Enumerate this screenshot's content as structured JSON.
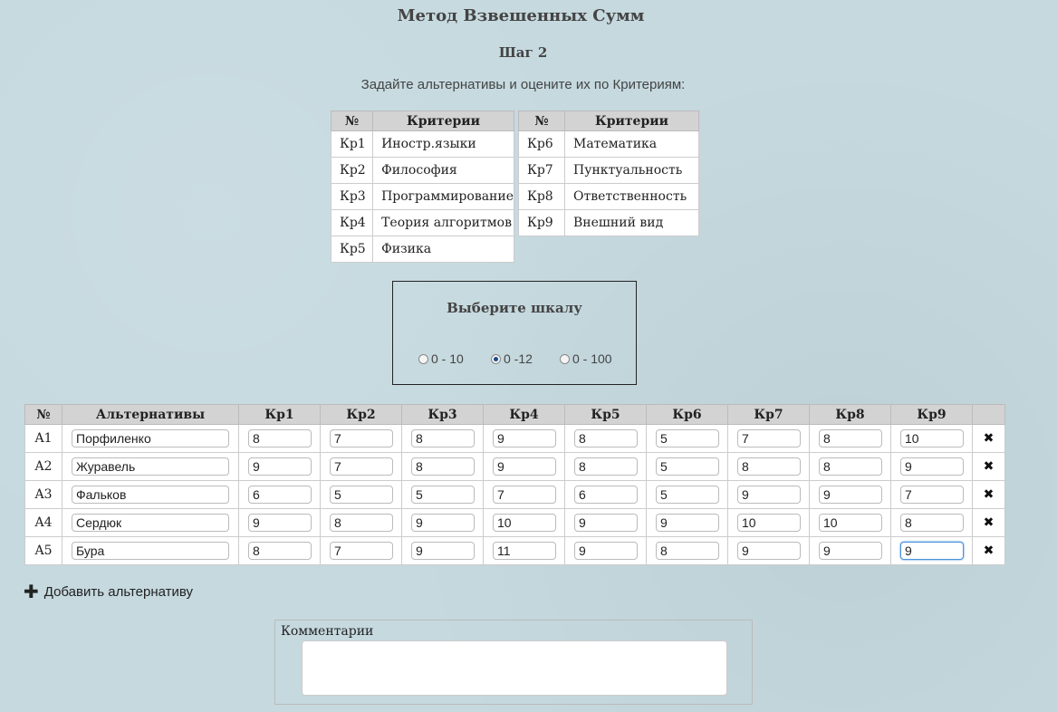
{
  "page": {
    "title": "Метод Взвешенных Сумм",
    "step": "Шаг 2",
    "instructions": "Задайте альтернативы и оцените их по Критериям:"
  },
  "criteria": {
    "headers": [
      "№",
      "Критерии"
    ],
    "left": [
      {
        "id": "Кр1",
        "name": "Иностр.языки"
      },
      {
        "id": "Кр2",
        "name": "Философия"
      },
      {
        "id": "Кр3",
        "name": "Программирование"
      },
      {
        "id": "Кр4",
        "name": "Теория алгоритмов"
      },
      {
        "id": "Кр5",
        "name": "Физика"
      }
    ],
    "right": [
      {
        "id": "Кр6",
        "name": "Математика"
      },
      {
        "id": "Кр7",
        "name": "Пунктуальность"
      },
      {
        "id": "Кр8",
        "name": "Ответственность"
      },
      {
        "id": "Кр9",
        "name": "Внешний вид"
      }
    ]
  },
  "scale": {
    "title": "Выберите шкалу",
    "options": [
      {
        "label": "0 - 10",
        "selected": false
      },
      {
        "label": "0 -12",
        "selected": true
      },
      {
        "label": "0 - 100",
        "selected": false
      }
    ]
  },
  "alternatives": {
    "headers": [
      "№",
      "Альтернативы",
      "Кр1",
      "Кр2",
      "Кр3",
      "Кр4",
      "Кр5",
      "Кр6",
      "Кр7",
      "Кр8",
      "Кр9"
    ],
    "delete_icon": "delete-icon",
    "rows": [
      {
        "id": "A1",
        "name": "Порфиленко",
        "scores": [
          "8",
          "7",
          "8",
          "9",
          "8",
          "5",
          "7",
          "8",
          "10"
        ]
      },
      {
        "id": "A2",
        "name": "Журавель",
        "scores": [
          "9",
          "7",
          "8",
          "9",
          "8",
          "5",
          "8",
          "8",
          "9"
        ]
      },
      {
        "id": "A3",
        "name": "Фальков",
        "scores": [
          "6",
          "5",
          "5",
          "7",
          "6",
          "5",
          "9",
          "9",
          "7"
        ]
      },
      {
        "id": "A4",
        "name": "Сердюк",
        "scores": [
          "9",
          "8",
          "9",
          "10",
          "9",
          "9",
          "10",
          "10",
          "8"
        ]
      },
      {
        "id": "A5",
        "name": "Бура",
        "scores": [
          "8",
          "7",
          "9",
          "11",
          "9",
          "8",
          "9",
          "9",
          "9"
        ]
      }
    ]
  },
  "actions": {
    "add_alternative": "Добавить альтернативу",
    "add_icon": "plus-icon"
  },
  "comments": {
    "label": "Комментарии",
    "value": ""
  }
}
